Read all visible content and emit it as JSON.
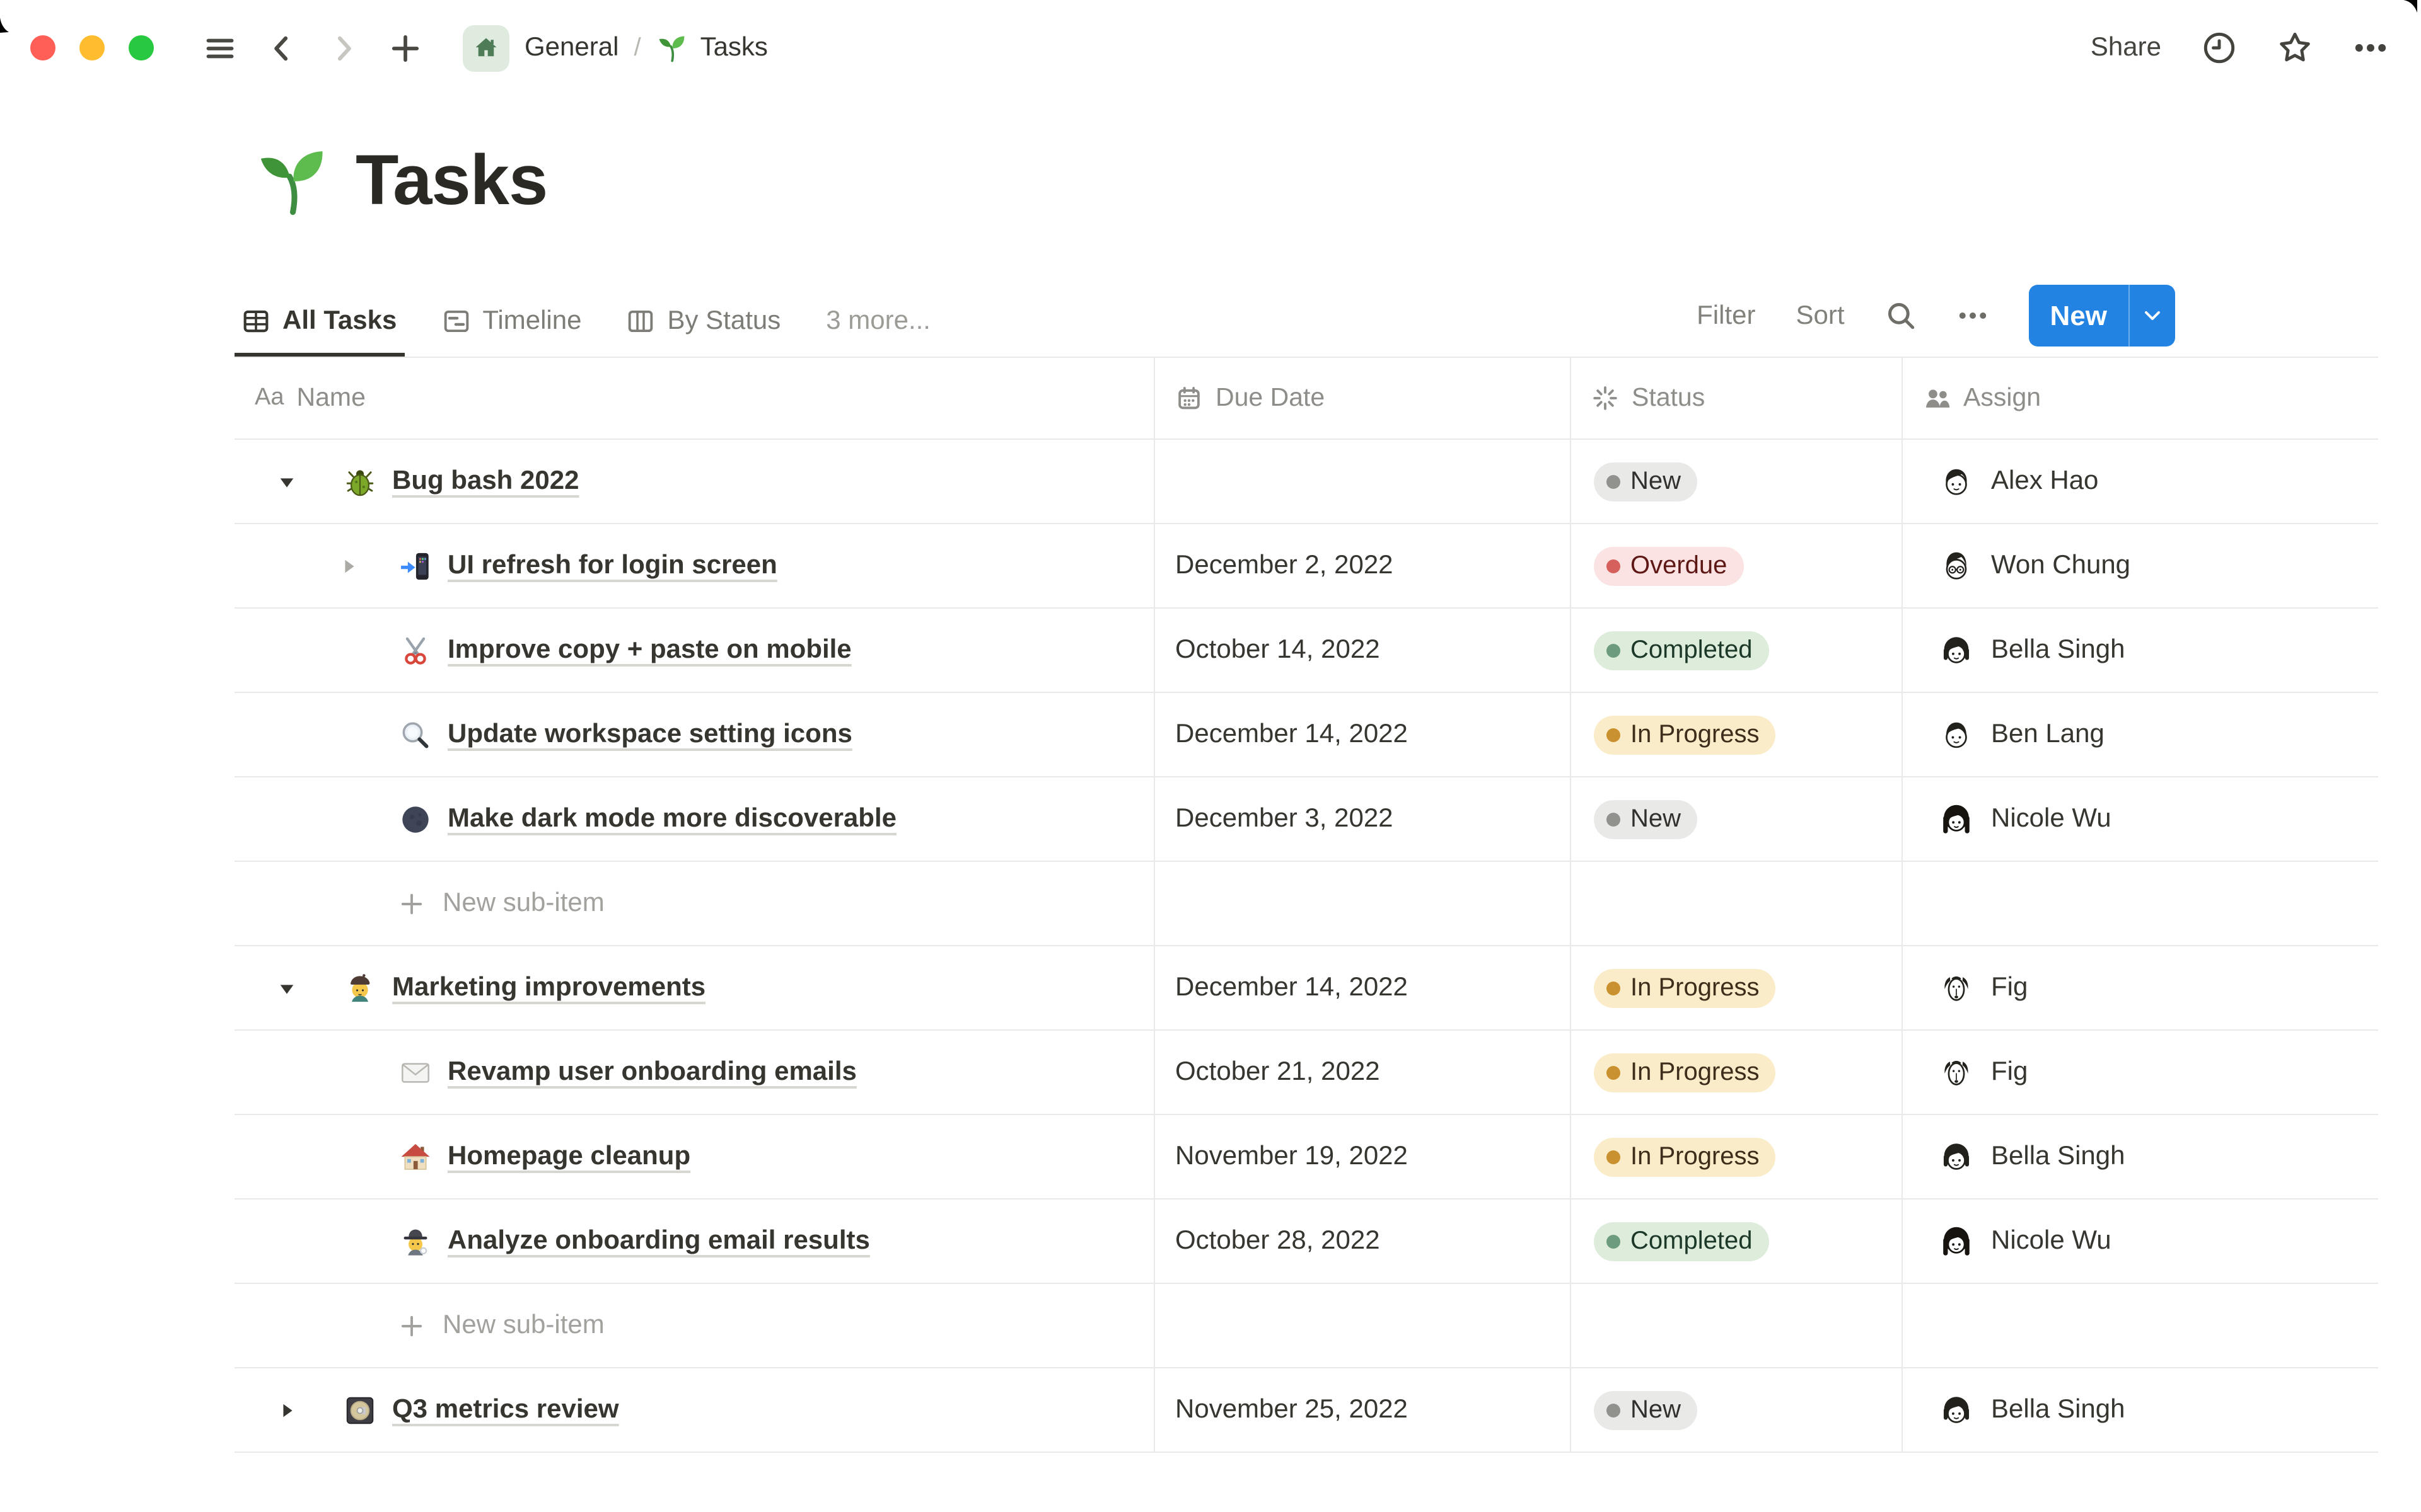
{
  "chrome": {
    "breadcrumb": {
      "root": "General",
      "separator": "/",
      "page": "Tasks"
    },
    "share_label": "Share"
  },
  "page": {
    "title": "Tasks"
  },
  "view_bar": {
    "tabs": [
      {
        "label": "All Tasks",
        "active": true
      },
      {
        "label": "Timeline",
        "active": false
      },
      {
        "label": "By Status",
        "active": false
      },
      {
        "label": "3 more...",
        "active": false
      }
    ],
    "filter_label": "Filter",
    "sort_label": "Sort",
    "new_button_label": "New"
  },
  "table": {
    "columns": [
      {
        "label": "Name",
        "icon": "text-icon",
        "icon_glyph": "Aa"
      },
      {
        "label": "Due Date",
        "icon": "calendar-icon"
      },
      {
        "label": "Status",
        "icon": "status-spinner-icon"
      },
      {
        "label": "Assign",
        "icon": "people-icon"
      }
    ],
    "new_sub_item_label": "New sub-item",
    "rows": [
      {
        "name": "Bug bash 2022",
        "emoji": "beetle",
        "due": "",
        "status": "New",
        "variant": "gray",
        "assignee": "Alex Hao"
      },
      {
        "name": "UI refresh for login screen",
        "emoji": "mobile-phone-with-arrow",
        "due": "December 2, 2022",
        "status": "Overdue",
        "variant": "red",
        "assignee": "Won Chung"
      },
      {
        "name": "Improve copy + paste on mobile",
        "emoji": "scissors",
        "due": "October 14, 2022",
        "status": "Completed",
        "variant": "green",
        "assignee": "Bella Singh"
      },
      {
        "name": "Update workspace setting icons",
        "emoji": "magnifying-glass",
        "due": "December 14, 2022",
        "status": "In Progress",
        "variant": "yellow",
        "assignee": "Ben Lang"
      },
      {
        "name": "Make dark mode more discoverable",
        "emoji": "new-moon",
        "due": "December 3, 2022",
        "status": "New",
        "variant": "gray",
        "assignee": "Nicole Wu"
      },
      {
        "name": "Marketing improvements",
        "emoji": "man-artist",
        "due": "December 14, 2022",
        "status": "In Progress",
        "variant": "yellow",
        "assignee": "Fig"
      },
      {
        "name": "Revamp user onboarding emails",
        "emoji": "envelope",
        "due": "October 21, 2022",
        "status": "In Progress",
        "variant": "yellow",
        "assignee": "Fig"
      },
      {
        "name": "Homepage cleanup",
        "emoji": "house",
        "due": "November 19, 2022",
        "status": "In Progress",
        "variant": "yellow",
        "assignee": "Bella Singh"
      },
      {
        "name": "Analyze onboarding email results",
        "emoji": "detective",
        "due": "October 28, 2022",
        "status": "Completed",
        "variant": "green",
        "assignee": "Nicole Wu"
      },
      {
        "name": "Q3 metrics review",
        "emoji": "computer-disk",
        "due": "November 25, 2022",
        "status": "New",
        "variant": "gray",
        "assignee": "Bella Singh"
      }
    ]
  },
  "colors": {
    "accent_blue": "#2383E2",
    "pill_gray_bg": "#E9E9E7",
    "pill_gray_dot": "#91918E",
    "pill_red_bg": "#FAE3E2",
    "pill_red_dot": "#D6615C",
    "pill_green_bg": "#DEECDC",
    "pill_green_dot": "#6C9B7D",
    "pill_yellow_bg": "#FAECC8",
    "pill_yellow_dot": "#C9912F",
    "home_badge_bg": "#DEEBDE",
    "home_badge_glyph": "#4E7C57"
  }
}
